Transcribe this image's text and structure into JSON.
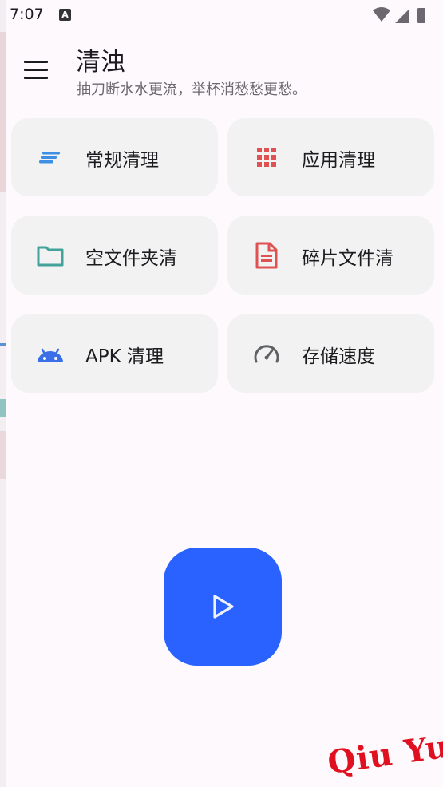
{
  "status_bar": {
    "time": "7:07",
    "notification_icon": "text-a-icon",
    "icons": [
      "wifi-icon",
      "cell-signal-icon",
      "battery-icon"
    ]
  },
  "header": {
    "menu_icon": "hamburger-menu-icon",
    "title": "清浊",
    "subtitle": "抽刀断水水更流，举杯消愁愁更愁。"
  },
  "tiles": [
    {
      "label": "常规清理",
      "icon": "lines-icon",
      "color": "#3d8fe3"
    },
    {
      "label": "应用清理",
      "icon": "grid-icon",
      "color": "#e05252"
    },
    {
      "label": "空文件夹清",
      "icon": "folder-icon",
      "color": "#43a39a"
    },
    {
      "label": "碎片文件清",
      "icon": "document-icon",
      "color": "#e05252"
    },
    {
      "label": "APK 清理",
      "icon": "android-icon",
      "color": "#3b6fe8"
    },
    {
      "label": "存储速度",
      "icon": "speedometer-icon",
      "color": "#5f6164"
    }
  ],
  "fab": {
    "icon": "play-icon",
    "color": "#2962ff"
  },
  "watermark": {
    "text": "Qiu Yue"
  }
}
